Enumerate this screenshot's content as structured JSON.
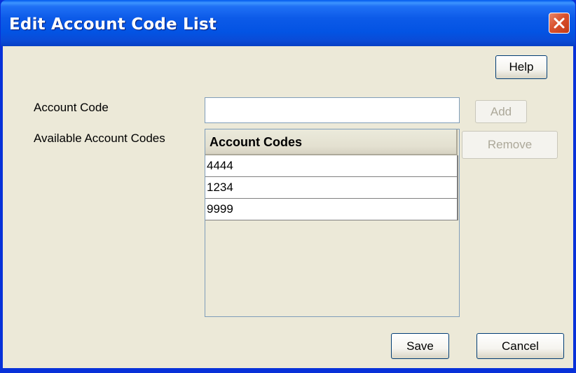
{
  "window": {
    "title": "Edit Account Code List"
  },
  "toolbar": {
    "help_label": "Help"
  },
  "form": {
    "account_code_label": "Account Code",
    "account_code_value": "",
    "available_codes_label": "Available Account Codes",
    "add_label": "Add",
    "remove_label": "Remove"
  },
  "table": {
    "header": "Account Codes",
    "rows": [
      "4444",
      "1234",
      "9999"
    ]
  },
  "footer": {
    "save_label": "Save",
    "cancel_label": "Cancel"
  },
  "icons": {
    "close": "close-icon"
  },
  "colors": {
    "title_bar": "#0054e3",
    "close_button": "#d9512d",
    "dialog_background": "#ece9d8"
  }
}
